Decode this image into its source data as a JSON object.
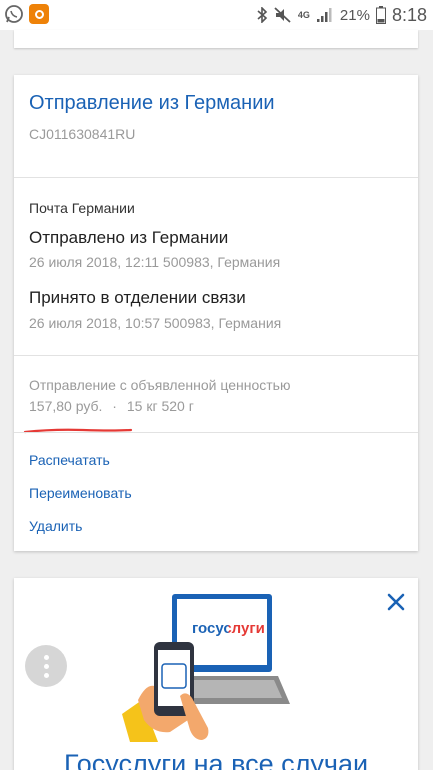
{
  "status_bar": {
    "clock": "8:18",
    "battery": "21%",
    "network": "4G",
    "icons": [
      "whatsapp-icon",
      "odnoklassniki-icon",
      "bluetooth-icon",
      "mute-icon",
      "signal-icon",
      "battery-icon"
    ]
  },
  "shipment": {
    "title": "Отправление из Германии",
    "tracking_number": "CJ011630841RU",
    "carrier": "Почта Германии",
    "events": [
      {
        "status": "Отправлено из Германии",
        "meta": "26 июля 2018, 12:11 500983, Германия"
      },
      {
        "status": "Принято в отделении связи",
        "meta": "26 июля 2018, 10:57 500983, Германия"
      }
    ],
    "type": "Отправление с объявленной ценностью",
    "value": "157,80 руб.",
    "separator": "·",
    "weight": "15 кг 520 г"
  },
  "actions": {
    "print": "Распечатать",
    "rename": "Переименовать",
    "delete": "Удалить"
  },
  "promo": {
    "logo_text": "госуслуги",
    "title": "Госуслуги на все случаи"
  },
  "colors": {
    "link": "#1a62b5",
    "underline": "#e53935",
    "background": "#efefef"
  }
}
